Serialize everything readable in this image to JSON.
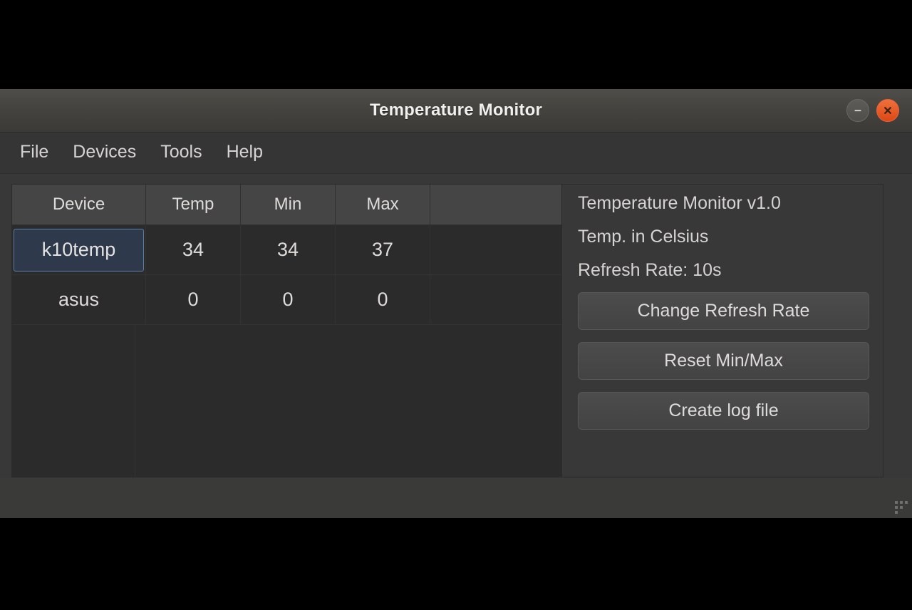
{
  "window": {
    "title": "Temperature Monitor",
    "controls": {
      "minimize_label": "minimize",
      "close_label": "close"
    }
  },
  "menubar": {
    "items": [
      {
        "label": "File"
      },
      {
        "label": "Devices"
      },
      {
        "label": "Tools"
      },
      {
        "label": "Help"
      }
    ]
  },
  "table": {
    "headers": [
      "Device",
      "Temp",
      "Min",
      "Max",
      ""
    ],
    "rows": [
      {
        "device": "k10temp",
        "temp": "34",
        "min": "34",
        "max": "37",
        "selected": true
      },
      {
        "device": "asus",
        "temp": "0",
        "min": "0",
        "max": "0",
        "selected": false
      }
    ]
  },
  "sidepanel": {
    "info": [
      "Temperature Monitor v1.0",
      "Temp. in Celsius",
      "Refresh Rate: 10s"
    ],
    "buttons": [
      {
        "label": "Change Refresh Rate"
      },
      {
        "label": "Reset Min/Max"
      },
      {
        "label": "Create log file"
      }
    ]
  },
  "colors": {
    "accent_close": "#dd4814",
    "selection": "#2e3a4b",
    "selection_border": "#5b7fa6",
    "titlebar": "#46443f",
    "content_bg": "#383838",
    "table_bg": "#2b2b2b",
    "header_bg": "#454545",
    "text": "#d6d4d2"
  }
}
